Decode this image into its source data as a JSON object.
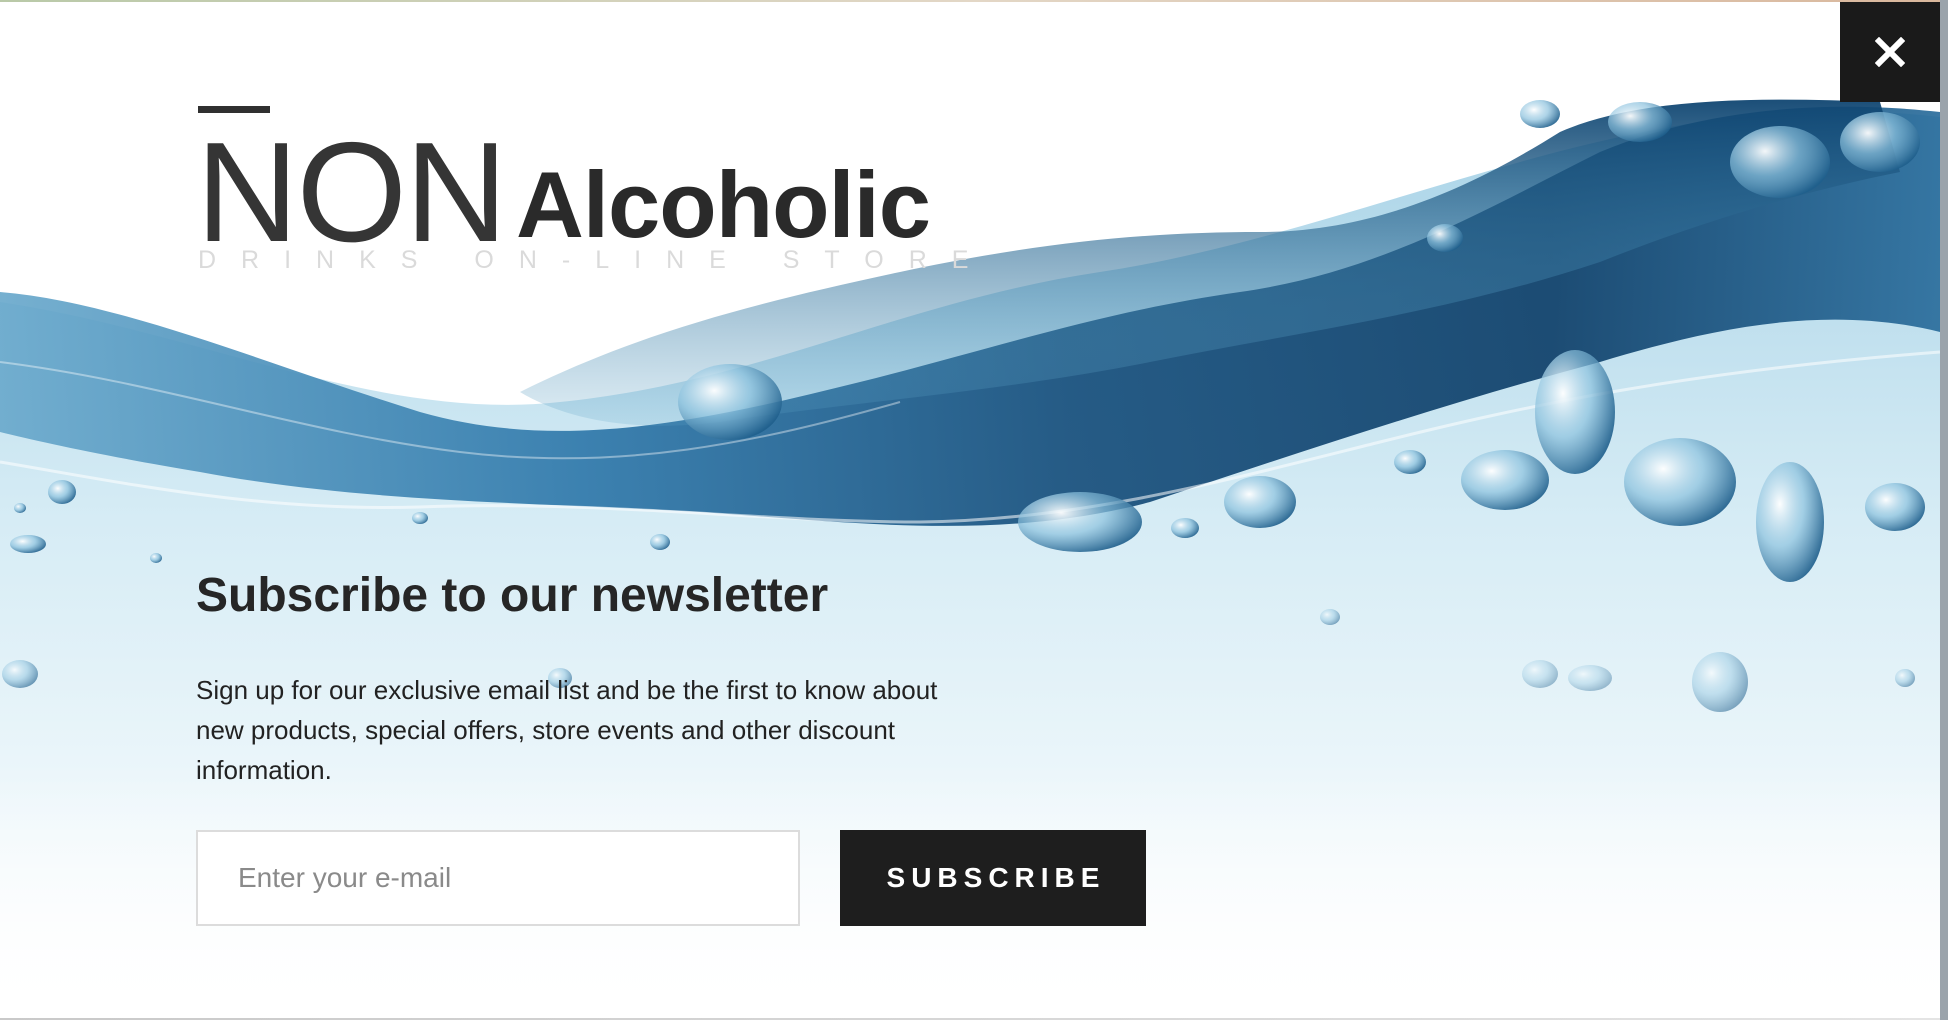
{
  "brand": {
    "logo_main": "NON",
    "logo_secondary": "Alcoholic",
    "tagline": "DRINKS ON-LINE STORE"
  },
  "popup": {
    "headline": "Subscribe to our newsletter",
    "description": "Sign up for our exclusive email list and be the first to know about new products, special offers, store events and other discount information.",
    "email_placeholder": "Enter your e-mail",
    "email_value": "",
    "subscribe_label": "SUBSCRIBE",
    "close_icon": "close-icon"
  },
  "colors": {
    "button_background": "#1e1e1e",
    "button_text": "#ffffff",
    "water_dark": "#0d4a78",
    "water_mid": "#3d84b3",
    "water_light": "#bfe0ef",
    "text_dark": "#262626",
    "tagline": "#dadada"
  }
}
